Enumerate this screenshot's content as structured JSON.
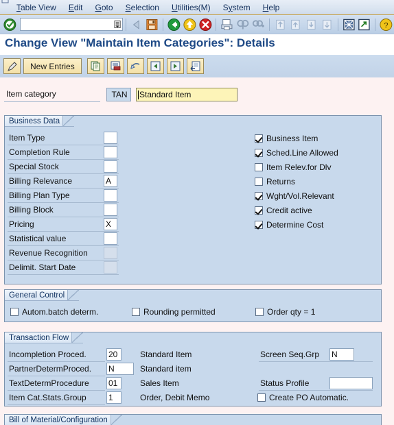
{
  "menubar": {
    "items": [
      {
        "label": "Table View",
        "accel": "T"
      },
      {
        "label": "Edit",
        "accel": "E"
      },
      {
        "label": "Goto",
        "accel": "G"
      },
      {
        "label": "Selection",
        "accel": "S"
      },
      {
        "label": "Utilities(M)",
        "accel": "U"
      },
      {
        "label": "System",
        "accel": "y"
      },
      {
        "label": "Help",
        "accel": "H"
      }
    ]
  },
  "systembar": {
    "command_value": "",
    "command_placeholder": "",
    "icons": [
      "enter-checkmark-icon",
      "back-arrow-icon",
      "save-icon",
      "back-green-icon",
      "exit-yellow-icon",
      "cancel-red-icon",
      "print-icon",
      "find-icon",
      "find-next-icon",
      "first-page-icon",
      "previous-page-icon",
      "next-page-icon",
      "last-page-icon",
      "new-session-icon",
      "create-shortcut-icon",
      "help-icon"
    ]
  },
  "title": "Change View \"Maintain Item Categories\": Details",
  "apptoolbar": {
    "buttons": [
      {
        "name": "display-change-button",
        "icon": "pencil-icon",
        "label": ""
      },
      {
        "name": "new-entries-button",
        "icon": "",
        "label": "New Entries"
      },
      {
        "name": "copy-as-button",
        "icon": "copy-icon",
        "label": ""
      },
      {
        "name": "delete-button",
        "icon": "delete-row-icon",
        "label": ""
      },
      {
        "name": "undo-button",
        "icon": "undo-icon",
        "label": ""
      },
      {
        "name": "previous-entry-button",
        "icon": "previous-entry-icon",
        "label": ""
      },
      {
        "name": "next-entry-button",
        "icon": "next-entry-icon",
        "label": ""
      },
      {
        "name": "other-entry-button",
        "icon": "other-entry-icon",
        "label": ""
      }
    ]
  },
  "itemcat": {
    "label": "Item category",
    "key": "TAN",
    "description": "Standard Item"
  },
  "business_data": {
    "section_title": "Business Data",
    "fields": [
      {
        "label": "Item Type",
        "value": "",
        "state": "enabled"
      },
      {
        "label": "Completion Rule",
        "value": "",
        "state": "enabled"
      },
      {
        "label": "Special Stock",
        "value": "",
        "state": "enabled"
      },
      {
        "label": "Billing Relevance",
        "value": "A",
        "state": "enabled"
      },
      {
        "label": "Billing Plan Type",
        "value": "",
        "state": "enabled"
      },
      {
        "label": "Billing Block",
        "value": "",
        "state": "enabled"
      },
      {
        "label": "Pricing",
        "value": "X",
        "state": "enabled"
      },
      {
        "label": "Statistical value",
        "value": "",
        "state": "enabled"
      },
      {
        "label": "Revenue Recognition",
        "value": "",
        "state": "disabled"
      },
      {
        "label": "Delimit. Start Date",
        "value": "",
        "state": "disabled"
      }
    ],
    "checkboxes": [
      {
        "label": "Business Item",
        "checked": true
      },
      {
        "label": "Sched.Line Allowed",
        "checked": true
      },
      {
        "label": "Item Relev.for Dlv",
        "checked": false
      },
      {
        "label": "Returns",
        "checked": false
      },
      {
        "label": "Wght/Vol.Relevant",
        "checked": true
      },
      {
        "label": "Credit active",
        "checked": true
      },
      {
        "label": "Determine Cost",
        "checked": true
      }
    ]
  },
  "general_control": {
    "section_title": "General Control",
    "checkboxes": [
      {
        "label": "Autom.batch determ.",
        "checked": false
      },
      {
        "label": "Rounding permitted",
        "checked": false
      },
      {
        "label": "Order qty = 1",
        "checked": false
      }
    ]
  },
  "transaction_flow": {
    "section_title": "Transaction Flow",
    "left_fields": [
      {
        "label": "Incompletion Proced.",
        "value": "20",
        "text": "Standard Item"
      },
      {
        "label": "PartnerDetermProced.",
        "value": "N",
        "text": "Standard item"
      },
      {
        "label": "TextDetermProcedure",
        "value": "01",
        "text": "Sales Item"
      },
      {
        "label": "Item Cat.Stats.Group",
        "value": "1",
        "text": "Order, Debit Memo"
      }
    ],
    "right_fields": [
      {
        "label": "Screen Seq.Grp",
        "value": "N"
      },
      {
        "label": "Status Profile",
        "value": ""
      }
    ],
    "right_checkbox": {
      "label": "Create PO Automatic.",
      "checked": false
    }
  },
  "bom_section": {
    "section_title": "Bill of Material/Configuration"
  },
  "colors": {
    "panel_bg": "#c8d9ec",
    "title_blue": "#1f4a86",
    "focus_yellow": "#fdf4b8",
    "readonly_blue": "#c9daec",
    "toolbar_button": "#f3e0a8"
  }
}
